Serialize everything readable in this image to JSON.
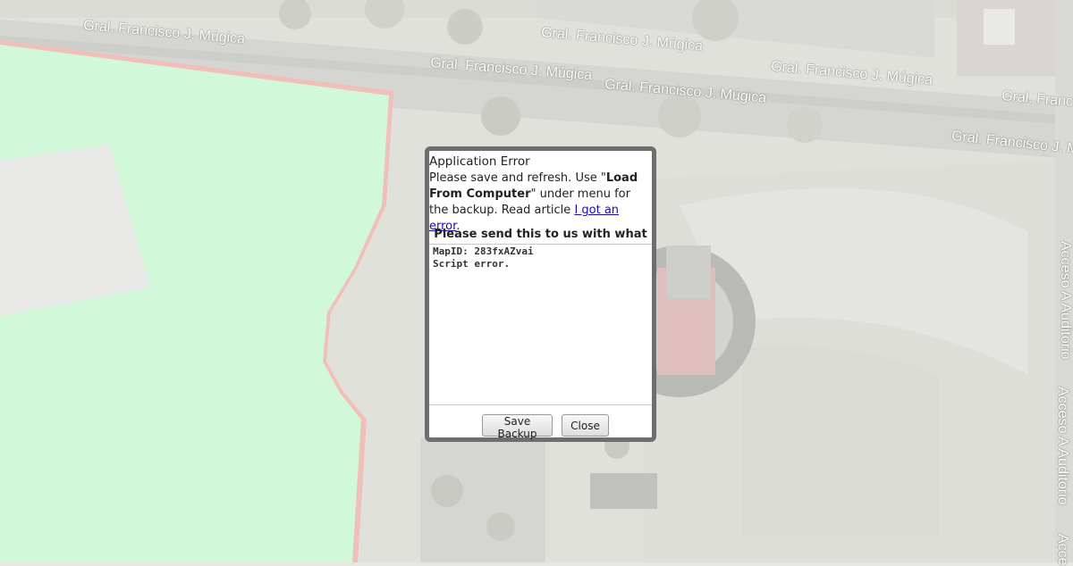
{
  "map": {
    "street_labels": [
      {
        "text": "Gral. Francisco J. Múgica"
      },
      {
        "text": "Gral. Francisco J. Múgica"
      },
      {
        "text": "Gral. Francisco J. Múgica"
      },
      {
        "text": "Gral. Francisco J. Múgica"
      },
      {
        "text": "Gral. Francisco J. Múgica"
      },
      {
        "text": "Gral. Franc"
      },
      {
        "text": "Gral. Francisco J. Múgica"
      },
      {
        "text": "Acceso A Auditorio"
      },
      {
        "text": "Acceso A Auditorio"
      },
      {
        "text": "Acce"
      }
    ],
    "colors": {
      "area_fill": "#c4ffd0",
      "area_border": "#f5a8a0",
      "gray_area": "#e6e6e6"
    }
  },
  "dialog": {
    "title": "Application Error",
    "msg_part1": "Please save and refresh. Use \"",
    "msg_bold": "Load From Computer",
    "msg_part2": "\" under menu for the backup. Read article ",
    "link_text": "I got an error",
    "msg_end": ".",
    "send_heading": "Please send this to us with what you",
    "error_text": "MapID: 283fxAZvai\nScript error.",
    "save_backup_label": "Save Backup",
    "close_label": "Close"
  }
}
